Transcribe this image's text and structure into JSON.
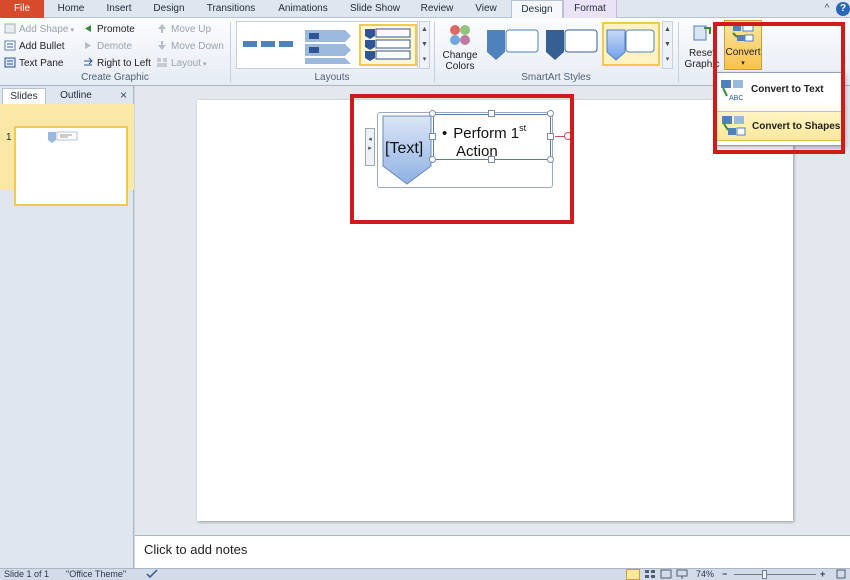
{
  "tabs": [
    {
      "label": "File"
    },
    {
      "label": "Home"
    },
    {
      "label": "Insert"
    },
    {
      "label": "Design"
    },
    {
      "label": "Transitions"
    },
    {
      "label": "Animations"
    },
    {
      "label": "Slide Show"
    },
    {
      "label": "Review"
    },
    {
      "label": "View"
    },
    {
      "label": "Design"
    },
    {
      "label": "Format"
    }
  ],
  "window": {
    "minimize_label": "^",
    "help_label": "?"
  },
  "ribbon": {
    "create_graphic": {
      "label": "Create Graphic",
      "add_shape": "Add Shape",
      "add_bullet": "Add Bullet",
      "text_pane": "Text Pane",
      "promote": "Promote",
      "demote": "Demote",
      "right_to_left": "Right to Left",
      "move_up": "Move Up",
      "move_down": "Move Down",
      "layout": "Layout"
    },
    "layouts": {
      "label": "Layouts"
    },
    "smartart_styles": {
      "label": "SmartArt Styles",
      "change_colors_line1": "Change",
      "change_colors_line2": "Colors"
    },
    "reset": {
      "line1": "Reset",
      "line2": "Graphic"
    },
    "convert": {
      "label": "Convert"
    }
  },
  "slides_panel": {
    "tab_slides": "Slides",
    "tab_outline": "Outline",
    "close": "×",
    "slide_number": "1"
  },
  "smartart": {
    "bullet_line1": "Perform 1",
    "bullet_sup": "st",
    "bullet_line2": "Action",
    "shape_text": "[Text]"
  },
  "convert_menu": {
    "items": [
      {
        "label": "Convert to Text"
      },
      {
        "label": "Convert to Shapes"
      }
    ]
  },
  "notes": {
    "placeholder": "Click to add notes"
  },
  "statusbar": {
    "slide_info": "Slide 1 of 1",
    "theme": "\"Office Theme\"",
    "zoom": "74%"
  },
  "colors": {
    "file_tab": "#d74a2b",
    "highlight_red": "#d11a1a",
    "smartart_blue": "#4f81bd"
  }
}
